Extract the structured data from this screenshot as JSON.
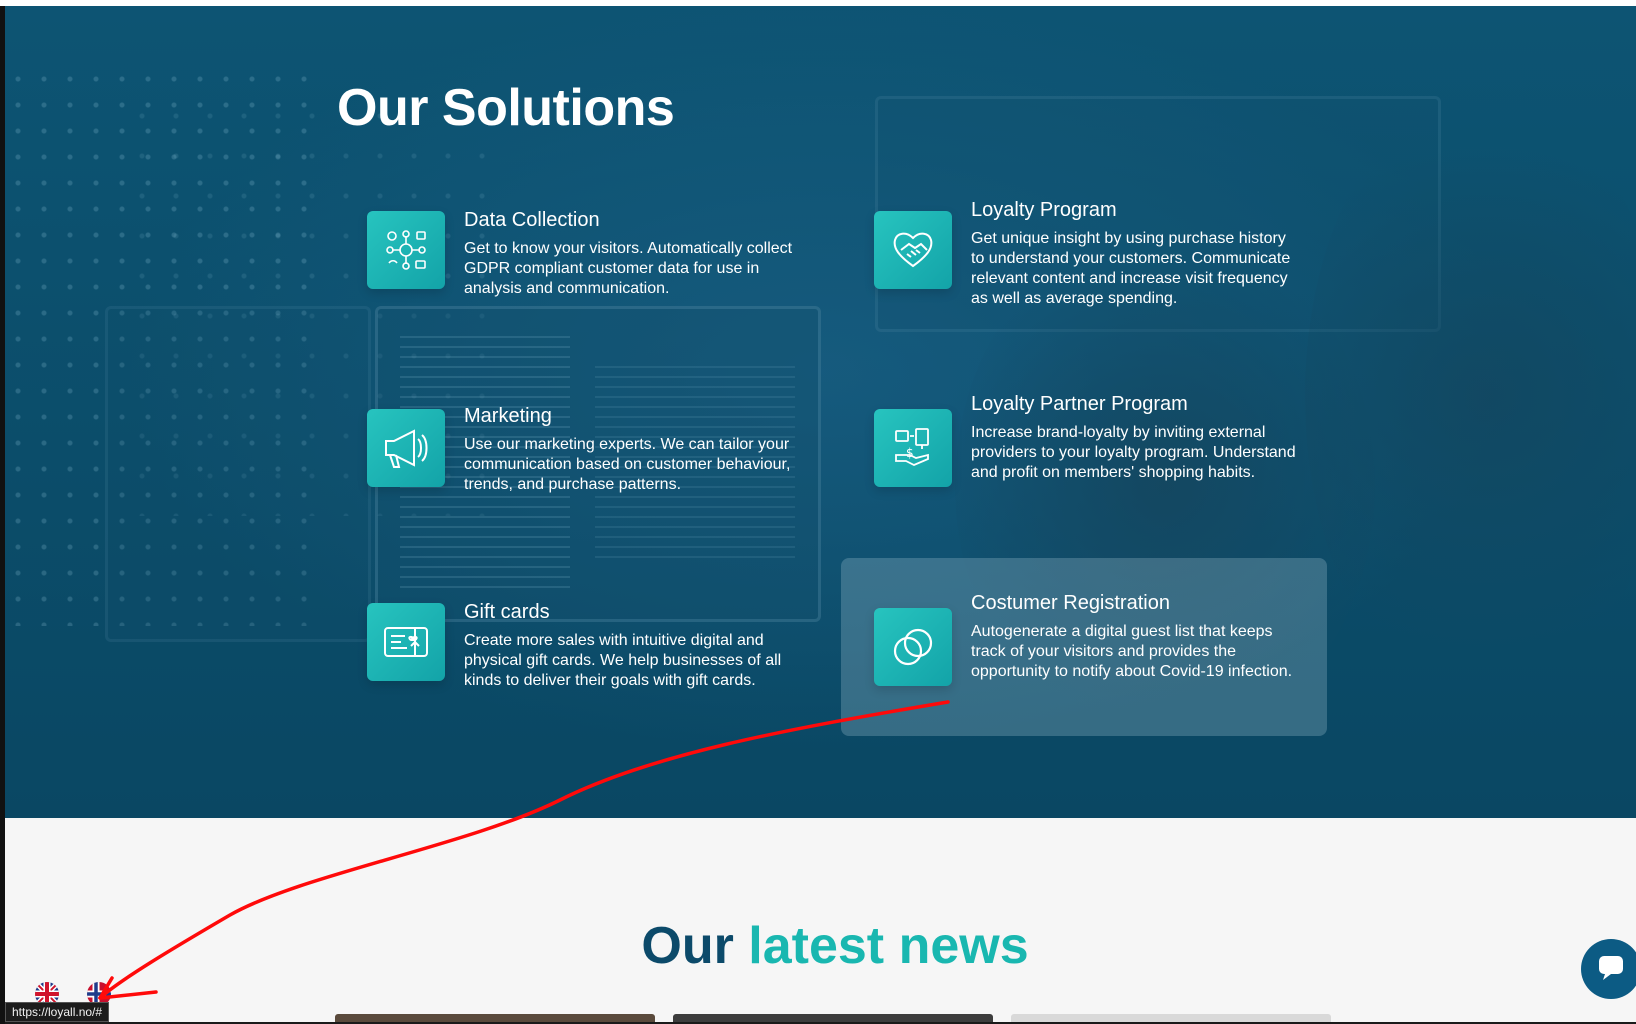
{
  "solutions": {
    "title": "Our Solutions",
    "items": [
      {
        "title": "Data Collection",
        "description": "Get to know your visitors. Automatically collect GDPR compliant customer data for use in analysis and communication.",
        "icon": "data-network-icon"
      },
      {
        "title": "Loyalty Program",
        "description": "Get unique insight by using purchase history to understand your customers. Communicate relevant content and increase visit frequency as well as average spending.",
        "icon": "heart-handshake-icon"
      },
      {
        "title": "Marketing",
        "description": "Use our marketing experts. We can tailor your communication based on customer behaviour, trends, and purchase patterns.",
        "icon": "megaphone-icon"
      },
      {
        "title": "Loyalty Partner Program",
        "description": "Increase brand-loyalty by inviting external providers to your loyalty program. Understand and profit on members' shopping habits.",
        "icon": "partner-hand-icon"
      },
      {
        "title": "Gift cards",
        "description": "Create more sales with intuitive digital and physical gift cards. We help businesses of all kinds to deliver their goals with gift cards.",
        "icon": "gift-card-icon"
      },
      {
        "title": "Costumer Registration",
        "description": "Autogenerate a digital guest list that keeps track of your visitors and provides the opportunity to notify about Covid-19 infection.",
        "icon": "rings-icon"
      }
    ]
  },
  "news": {
    "title_part1": "Our",
    "title_part2": "latest news"
  },
  "language": {
    "options": [
      "uk-flag-icon",
      "norway-flag-icon"
    ]
  },
  "chat": {
    "icon": "chat-bubble-icon"
  },
  "status_bar": {
    "url": "https://loyall.no/#"
  },
  "colors": {
    "hero_bg": "#0b4d6a",
    "icon_teal": "#1bb3b0",
    "news_dark": "#0c4a6a",
    "news_accent": "#19b7b0",
    "annotation_red": "#ff0000"
  }
}
